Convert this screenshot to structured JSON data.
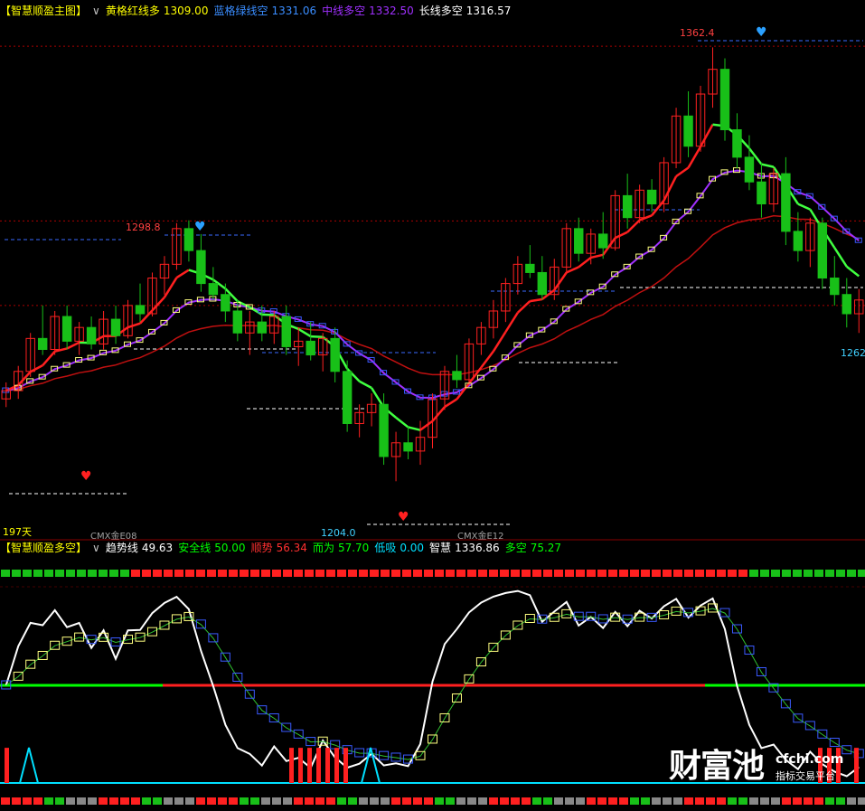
{
  "main_panel": {
    "title": "【智慧顺盈主图】",
    "indicators": [
      {
        "label": "黄格红线多",
        "value": "1309.00",
        "color": "#ffff00"
      },
      {
        "label": "蓝格绿线空",
        "value": "1331.06",
        "color": "#3a8dff"
      },
      {
        "label": "中线多空",
        "value": "1332.50",
        "color": "#a030ff"
      },
      {
        "label": "长线多空",
        "value": "1316.57",
        "color": "#ffffff"
      }
    ],
    "price_labels": {
      "high_1": "1298.8",
      "high_2": "1362.4",
      "low_1": "1204.0",
      "right_edge": "1262"
    },
    "bottom_labels": {
      "days": "197天",
      "contract_1": "CMX金E08",
      "contract_2": "CMX金E12"
    }
  },
  "sub_panel": {
    "title": "【智慧顺盈多空】",
    "indicators": [
      {
        "label": "趋势线",
        "value": "49.63",
        "color": "#ffffff"
      },
      {
        "label": "安全线",
        "value": "50.00",
        "color": "#00ff00"
      },
      {
        "label": "顺势",
        "value": "56.34",
        "color": "#ff3030"
      },
      {
        "label": "而为",
        "value": "57.70",
        "color": "#00ff00"
      },
      {
        "label": "低吸",
        "value": "0.00",
        "color": "#00e0ff"
      },
      {
        "label": "智慧",
        "value": "1336.86",
        "color": "#ffffff"
      },
      {
        "label": "多空",
        "value": "75.27",
        "color": "#00ff00"
      }
    ]
  },
  "watermark": {
    "brand": "财富池",
    "domain": "cfchi.com",
    "slogan": "指标交易平台"
  },
  "colors": {
    "up_candle": "#ff2020",
    "down_candle": "#18c018",
    "red_line": "#ff2020",
    "green_line": "#40ff40",
    "purple_line": "#a030ff",
    "dark_red_line": "#c01010",
    "yellow_box": "#ffff80",
    "blue_box": "#3a5aff"
  },
  "chart_data": {
    "type": "candlestick",
    "title": "【智慧顺盈主图】",
    "ylim": [
      1185,
      1372
    ],
    "candles": [
      [
        1234,
        1240,
        1231,
        1237
      ],
      [
        1237,
        1246,
        1234,
        1244
      ],
      [
        1244,
        1258,
        1242,
        1256
      ],
      [
        1256,
        1268,
        1250,
        1252
      ],
      [
        1252,
        1266,
        1250,
        1264
      ],
      [
        1264,
        1268,
        1252,
        1255
      ],
      [
        1255,
        1262,
        1250,
        1260
      ],
      [
        1260,
        1264,
        1252,
        1254
      ],
      [
        1254,
        1266,
        1252,
        1263
      ],
      [
        1263,
        1268,
        1254,
        1257
      ],
      [
        1257,
        1270,
        1256,
        1268
      ],
      [
        1268,
        1276,
        1262,
        1265
      ],
      [
        1265,
        1280,
        1264,
        1278
      ],
      [
        1278,
        1286,
        1272,
        1283
      ],
      [
        1283,
        1298,
        1281,
        1296
      ],
      [
        1296,
        1299,
        1284,
        1288
      ],
      [
        1288,
        1294,
        1273,
        1276
      ],
      [
        1276,
        1282,
        1270,
        1272
      ],
      [
        1272,
        1276,
        1262,
        1266
      ],
      [
        1266,
        1270,
        1255,
        1258
      ],
      [
        1258,
        1266,
        1250,
        1262
      ],
      [
        1262,
        1268,
        1255,
        1258
      ],
      [
        1258,
        1266,
        1254,
        1264
      ],
      [
        1264,
        1268,
        1250,
        1253
      ],
      [
        1253,
        1260,
        1246,
        1255
      ],
      [
        1255,
        1262,
        1248,
        1250
      ],
      [
        1250,
        1258,
        1244,
        1256
      ],
      [
        1256,
        1260,
        1240,
        1244
      ],
      [
        1244,
        1248,
        1222,
        1225
      ],
      [
        1225,
        1232,
        1220,
        1229
      ],
      [
        1229,
        1236,
        1224,
        1232
      ],
      [
        1232,
        1236,
        1210,
        1213
      ],
      [
        1213,
        1222,
        1204,
        1218
      ],
      [
        1218,
        1224,
        1212,
        1215
      ],
      [
        1215,
        1226,
        1210,
        1220
      ],
      [
        1220,
        1236,
        1216,
        1234
      ],
      [
        1234,
        1246,
        1230,
        1244
      ],
      [
        1244,
        1250,
        1238,
        1241
      ],
      [
        1241,
        1256,
        1240,
        1254
      ],
      [
        1254,
        1262,
        1250,
        1260
      ],
      [
        1260,
        1270,
        1256,
        1266
      ],
      [
        1266,
        1278,
        1262,
        1276
      ],
      [
        1276,
        1286,
        1272,
        1283
      ],
      [
        1283,
        1290,
        1278,
        1280
      ],
      [
        1280,
        1286,
        1270,
        1272
      ],
      [
        1272,
        1285,
        1270,
        1282
      ],
      [
        1282,
        1298,
        1280,
        1296
      ],
      [
        1296,
        1300,
        1284,
        1287
      ],
      [
        1287,
        1296,
        1283,
        1294
      ],
      [
        1294,
        1302,
        1285,
        1289
      ],
      [
        1289,
        1310,
        1288,
        1308
      ],
      [
        1308,
        1316,
        1296,
        1300
      ],
      [
        1300,
        1312,
        1298,
        1310
      ],
      [
        1310,
        1314,
        1302,
        1305
      ],
      [
        1305,
        1322,
        1302,
        1320
      ],
      [
        1320,
        1340,
        1318,
        1337
      ],
      [
        1337,
        1346,
        1322,
        1326
      ],
      [
        1326,
        1348,
        1324,
        1345
      ],
      [
        1345,
        1362,
        1340,
        1354
      ],
      [
        1354,
        1358,
        1328,
        1332
      ],
      [
        1332,
        1338,
        1318,
        1322
      ],
      [
        1322,
        1330,
        1310,
        1313
      ],
      [
        1313,
        1320,
        1300,
        1305
      ],
      [
        1305,
        1318,
        1302,
        1316
      ],
      [
        1316,
        1322,
        1290,
        1295
      ],
      [
        1295,
        1302,
        1284,
        1288
      ],
      [
        1288,
        1300,
        1282,
        1298
      ],
      [
        1298,
        1300,
        1274,
        1278
      ],
      [
        1278,
        1286,
        1268,
        1272
      ],
      [
        1272,
        1278,
        1260,
        1265
      ],
      [
        1265,
        1274,
        1258,
        1270
      ]
    ]
  }
}
